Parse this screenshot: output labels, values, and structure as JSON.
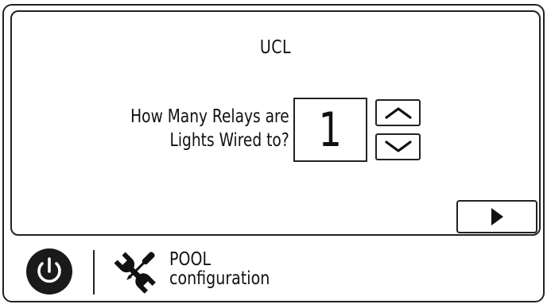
{
  "screen": {
    "title": "UCL",
    "question_line1": "How Many Relays are",
    "question_line2": "Lights Wired to?",
    "value": "1"
  },
  "icons": {
    "stepper_up": "chevron-up-icon",
    "stepper_down": "chevron-down-icon",
    "next": "play-triangle-icon",
    "power": "power-icon",
    "tools": "wrench-screwdriver-icon"
  },
  "footer": {
    "mode_line1": "POOL",
    "mode_line2": "configuration"
  },
  "colors": {
    "foreground": "#111111",
    "background": "#ffffff"
  }
}
